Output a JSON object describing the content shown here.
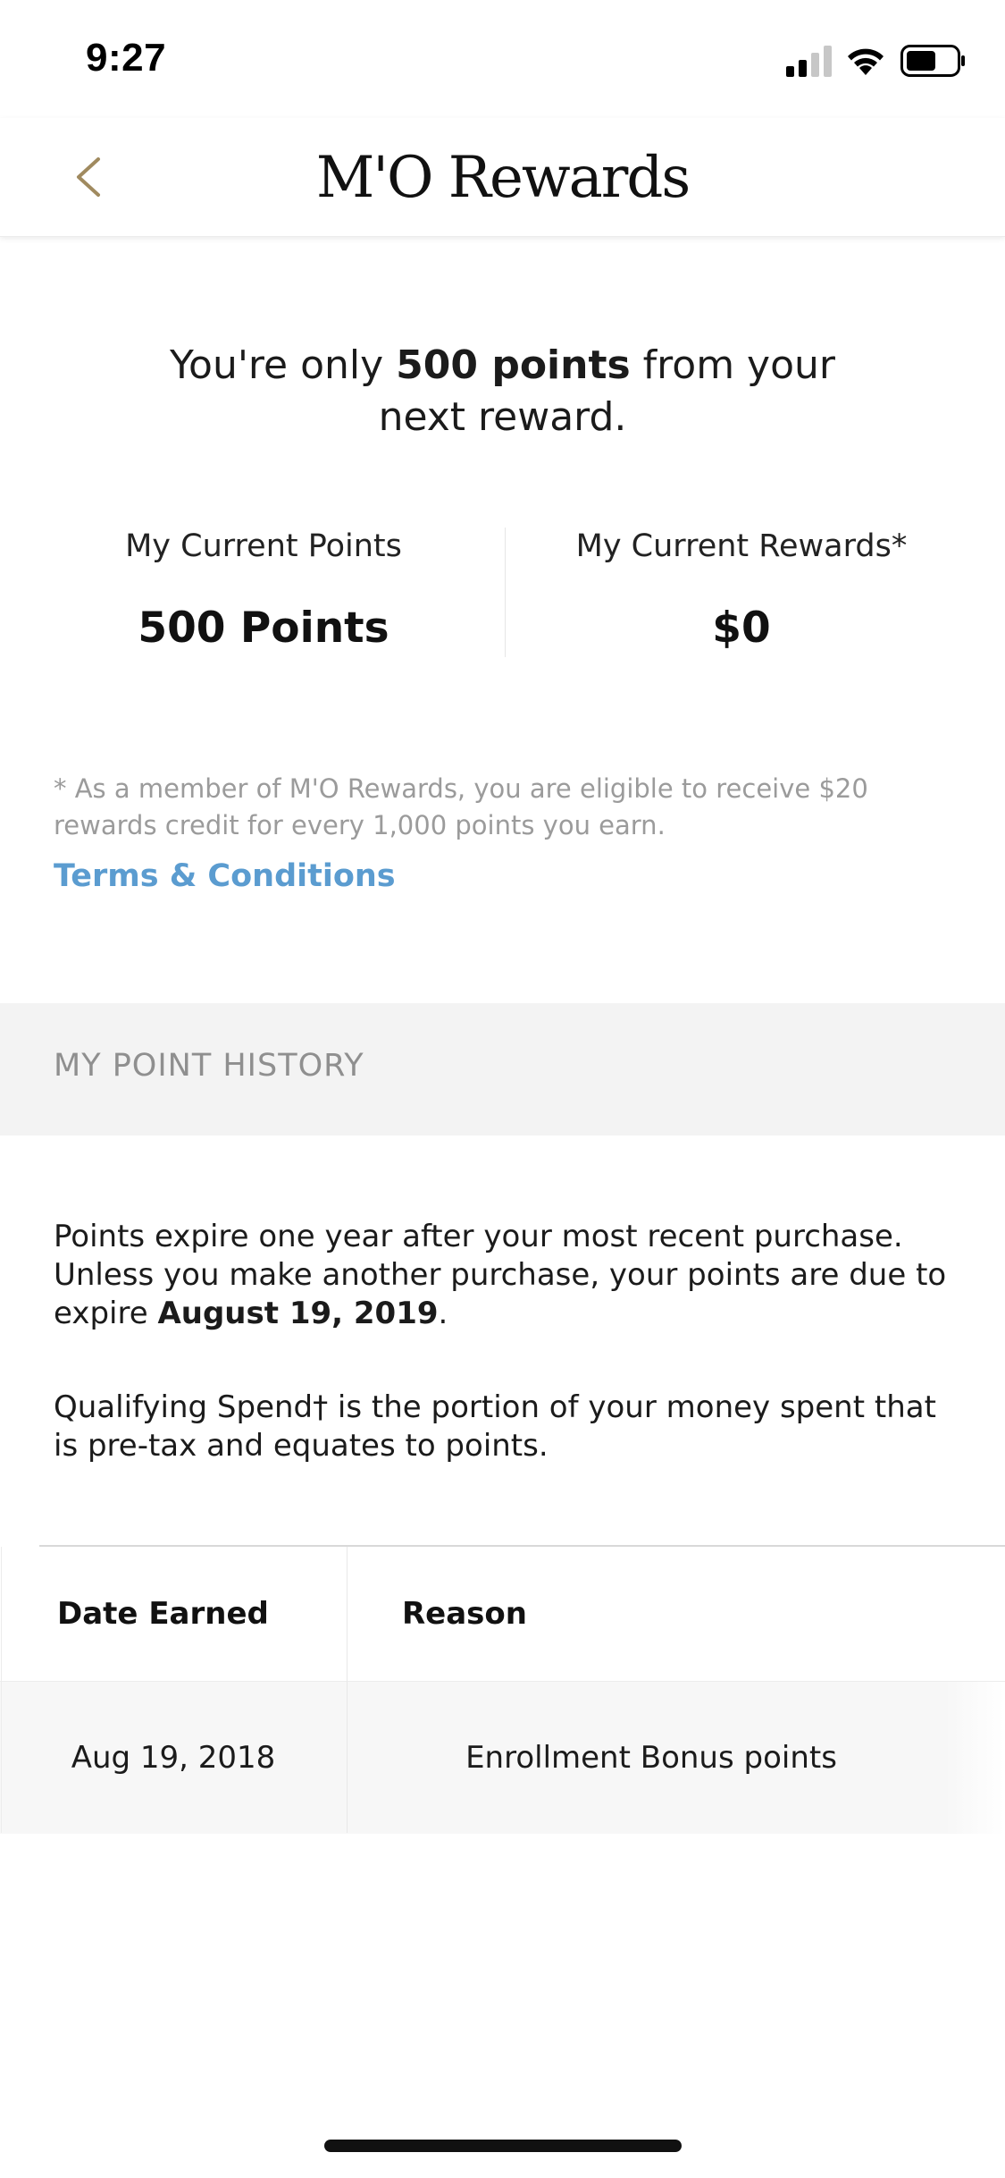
{
  "status_bar": {
    "time": "9:27",
    "icons": [
      "cellular-signal-icon",
      "wifi-icon",
      "battery-icon"
    ]
  },
  "nav": {
    "back_icon": "chevron-left-icon",
    "title": "M'O Rewards"
  },
  "summary": {
    "headline_prefix": "You're only ",
    "headline_bold": "500 points",
    "headline_suffix": " from your next reward.",
    "points_label": "My Current Points",
    "points_value": "500 Points",
    "rewards_label": "My Current Rewards*",
    "rewards_value": "$0",
    "footnote": "* As a member of M'O Rewards, you are eligible to receive $20 rewards credit for every 1,000 points you earn.",
    "terms_link": "Terms & Conditions"
  },
  "history": {
    "section_title": "MY POINT HISTORY",
    "expire_text_prefix": "Points expire one year after your most recent purchase. Unless you make another purchase, your points are due to expire ",
    "expire_date": "August 19, 2019",
    "expire_text_suffix": ".",
    "qualifying_text": "Qualifying Spend† is the portion of your money spent that is pre-tax and equates to points.",
    "columns": [
      "Date Earned",
      "Reason"
    ],
    "rows": [
      {
        "date": "Aug 19, 2018",
        "reason": "Enrollment Bonus points"
      }
    ]
  },
  "colors": {
    "accent_gold": "#a08a5f",
    "link_blue": "#5b9cd0",
    "muted_gray": "#9b9b9b",
    "section_bg": "#f3f3f3"
  }
}
